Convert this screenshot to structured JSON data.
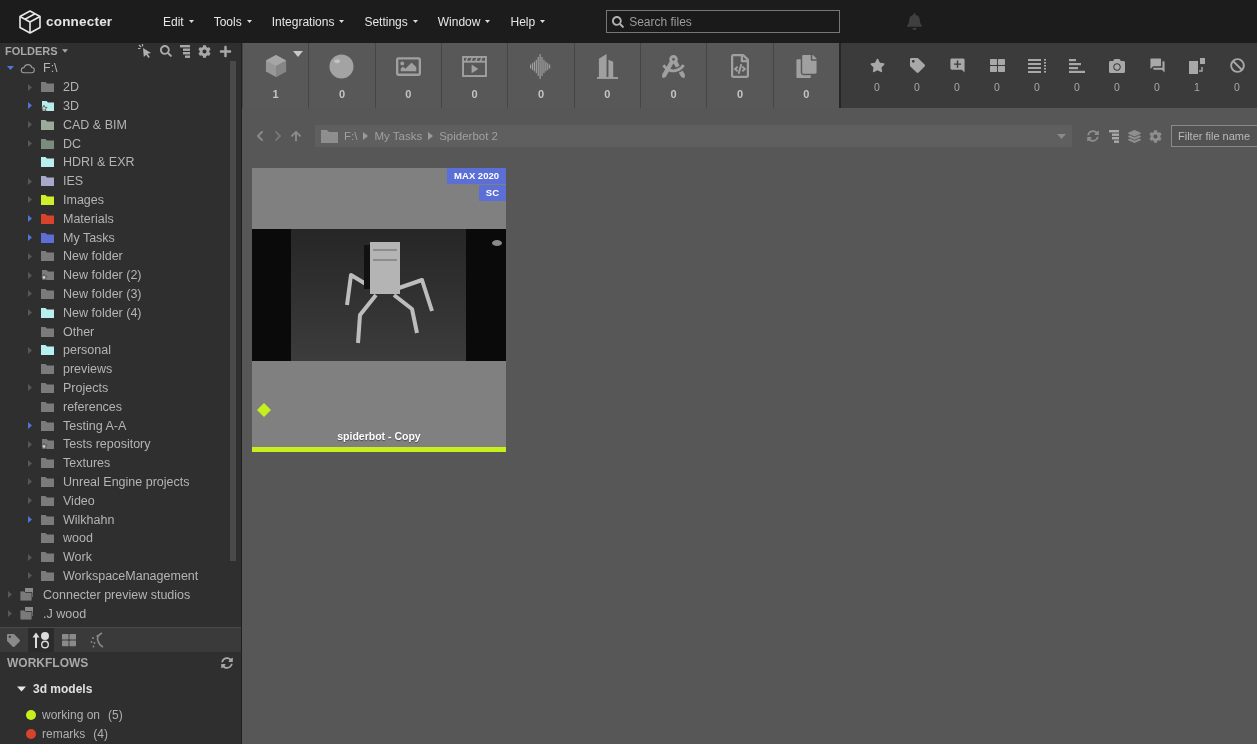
{
  "app": {
    "logo_text": "connecter"
  },
  "menu": [
    {
      "label": "Edit"
    },
    {
      "label": "Tools"
    },
    {
      "label": "Integrations"
    },
    {
      "label": "Settings"
    },
    {
      "label": "Window"
    },
    {
      "label": "Help"
    }
  ],
  "search": {
    "placeholder": "Search files"
  },
  "folders_panel": {
    "title": "FOLDERS",
    "tree": [
      {
        "label": "F:\\",
        "kind": "drive",
        "expandable": true,
        "arrow_highlighted": true,
        "expanded": true,
        "children": [
          {
            "label": "2D",
            "kind": "folder",
            "color": "#7b7b7b",
            "starred": false,
            "expandable": true,
            "arrow_highlighted": false,
            "expanded": false
          },
          {
            "label": "3D",
            "kind": "folder",
            "color": "#b7ecec",
            "starred": true,
            "expandable": true,
            "arrow_highlighted": true,
            "expanded": false
          },
          {
            "label": "CAD & BIM",
            "kind": "folder",
            "color": "#9aaa9c",
            "starred": false,
            "expandable": true,
            "arrow_highlighted": false,
            "expanded": false
          },
          {
            "label": "DC",
            "kind": "folder",
            "color": "#7b8c7e",
            "starred": false,
            "expandable": true,
            "arrow_highlighted": false,
            "expanded": false
          },
          {
            "label": "HDRI & EXR",
            "kind": "folder",
            "color": "#b8f0ef",
            "starred": false,
            "expandable": false
          },
          {
            "label": "IES",
            "kind": "folder",
            "color": "#a8a8cc",
            "starred": false,
            "expandable": true,
            "arrow_highlighted": false,
            "expanded": false
          },
          {
            "label": "Images",
            "kind": "folder",
            "color": "#cdf02a",
            "starred": false,
            "expandable": true,
            "arrow_highlighted": false,
            "expanded": false
          },
          {
            "label": "Materials",
            "kind": "folder",
            "color": "#d9432c",
            "starred": false,
            "expandable": true,
            "arrow_highlighted": true,
            "expanded": false
          },
          {
            "label": "My Tasks",
            "kind": "folder",
            "color": "#5f6dd6",
            "starred": false,
            "expandable": true,
            "arrow_highlighted": true,
            "expanded": false
          },
          {
            "label": "New folder",
            "kind": "folder",
            "color": "#7b7b7b",
            "starred": false,
            "expandable": true,
            "arrow_highlighted": false,
            "expanded": false
          },
          {
            "label": "New folder (2)",
            "kind": "folder",
            "color": "#7b7b7b",
            "starred": true,
            "expandable": true,
            "arrow_highlighted": false,
            "expanded": false
          },
          {
            "label": "New folder (3)",
            "kind": "folder",
            "color": "#7b7b7b",
            "starred": false,
            "expandable": true,
            "arrow_highlighted": false,
            "expanded": false
          },
          {
            "label": "New folder (4)",
            "kind": "folder",
            "color": "#b8f0ef",
            "starred": false,
            "expandable": true,
            "arrow_highlighted": false,
            "expanded": false
          },
          {
            "label": "Other",
            "kind": "folder",
            "color": "#7b7b7b",
            "starred": false,
            "expandable": false
          },
          {
            "label": "personal",
            "kind": "folder",
            "color": "#b8f0ef",
            "starred": false,
            "expandable": true,
            "arrow_highlighted": false,
            "expanded": false
          },
          {
            "label": "previews",
            "kind": "folder",
            "color": "#7b7b7b",
            "starred": false,
            "expandable": false
          },
          {
            "label": "Projects",
            "kind": "folder",
            "color": "#7b7b7b",
            "starred": false,
            "expandable": true,
            "arrow_highlighted": false,
            "expanded": false
          },
          {
            "label": "references",
            "kind": "folder",
            "color": "#7b7b7b",
            "starred": false,
            "expandable": false
          },
          {
            "label": "Testing A-A",
            "kind": "folder",
            "color": "#7b7b7b",
            "starred": false,
            "expandable": true,
            "arrow_highlighted": true,
            "expanded": false
          },
          {
            "label": "Tests repository",
            "kind": "folder",
            "color": "#7b7b7b",
            "starred": true,
            "expandable": true,
            "arrow_highlighted": false,
            "expanded": false
          },
          {
            "label": "Textures",
            "kind": "folder",
            "color": "#7b7b7b",
            "starred": false,
            "expandable": true,
            "arrow_highlighted": false,
            "expanded": false
          },
          {
            "label": "Unreal Engine projects",
            "kind": "folder",
            "color": "#7b7b7b",
            "starred": false,
            "expandable": true,
            "arrow_highlighted": false,
            "expanded": false
          },
          {
            "label": "Video",
            "kind": "folder",
            "color": "#7b7b7b",
            "starred": false,
            "expandable": true,
            "arrow_highlighted": false,
            "expanded": false
          },
          {
            "label": "Wilkhahn",
            "kind": "folder",
            "color": "#7b7b7b",
            "starred": false,
            "expandable": true,
            "arrow_highlighted": true,
            "expanded": false
          },
          {
            "label": "wood",
            "kind": "folder",
            "color": "#7b7b7b",
            "starred": false,
            "expandable": false
          },
          {
            "label": "Work",
            "kind": "folder",
            "color": "#7b7b7b",
            "starred": false,
            "expandable": true,
            "arrow_highlighted": false,
            "expanded": false
          },
          {
            "label": "WorkspaceManagement",
            "kind": "folder",
            "color": "#7b7b7b",
            "starred": false,
            "expandable": true,
            "arrow_highlighted": false,
            "expanded": false
          }
        ]
      },
      {
        "label": "Connecter preview studios",
        "kind": "library",
        "expandable": true,
        "arrow_highlighted": false,
        "expanded": false
      },
      {
        "label": ".J wood",
        "kind": "library",
        "expandable": true,
        "arrow_highlighted": false,
        "expanded": false
      }
    ]
  },
  "side_tabs": [
    {
      "selected": false
    },
    {
      "selected": true
    },
    {
      "selected": false
    },
    {
      "selected": false
    }
  ],
  "workflows": {
    "title": "WORKFLOWS",
    "groups": [
      {
        "label": "3d models",
        "expanded": true,
        "states": [
          {
            "label": "working on",
            "count": "(5)",
            "color": "#c6f01c"
          },
          {
            "label": "remarks",
            "count": "(4)",
            "color": "#d9432c"
          }
        ]
      }
    ]
  },
  "type_filters": [
    {
      "count": "1",
      "has_menu": true
    },
    {
      "count": "0",
      "has_menu": false
    },
    {
      "count": "0",
      "has_menu": false
    },
    {
      "count": "0",
      "has_menu": false
    },
    {
      "count": "0",
      "has_menu": false
    },
    {
      "count": "0",
      "has_menu": false
    },
    {
      "count": "0",
      "has_menu": false
    },
    {
      "count": "0",
      "has_menu": false
    },
    {
      "count": "0",
      "has_menu": false
    }
  ],
  "tag_filters": [
    {
      "count": "0"
    },
    {
      "count": "0"
    },
    {
      "count": "0"
    },
    {
      "count": "0"
    },
    {
      "count": "0"
    },
    {
      "count": "0"
    },
    {
      "count": "0"
    },
    {
      "count": "0"
    },
    {
      "count": "1"
    },
    {
      "count": "0"
    }
  ],
  "path_bar": {
    "segments": [
      "F:\\",
      "My Tasks",
      "Spiderbot 2"
    ]
  },
  "filter": {
    "placeholder": "Filter file name"
  },
  "files": [
    {
      "name": "spiderbot - Copy",
      "badges": [
        "MAX 2020",
        "SC"
      ],
      "color": "#c6f01c"
    }
  ]
}
